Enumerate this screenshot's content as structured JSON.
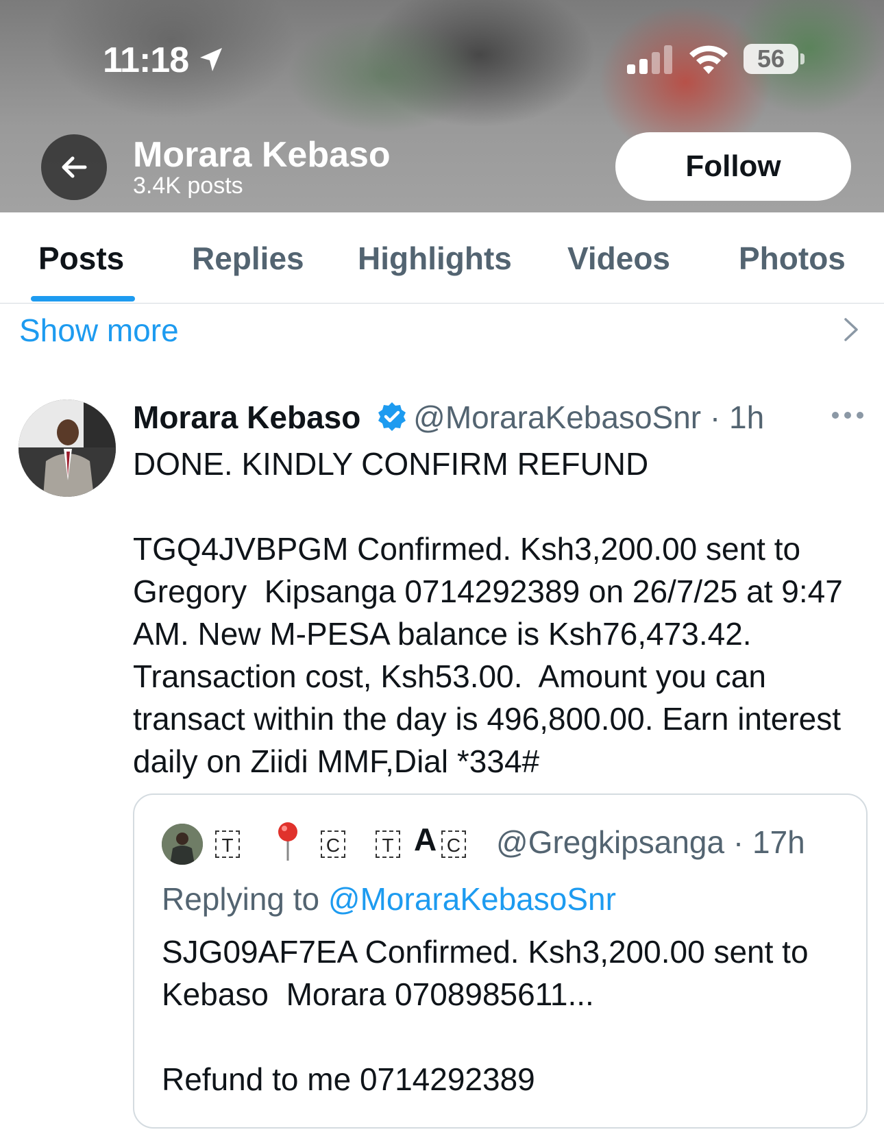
{
  "status_bar": {
    "time": "11:18",
    "battery": "56"
  },
  "header": {
    "name": "Morara Kebaso",
    "posts_count": "3.4K posts",
    "follow_label": "Follow"
  },
  "tabs": [
    {
      "label": "Posts",
      "active": true
    },
    {
      "label": "Replies",
      "active": false
    },
    {
      "label": "Highlights",
      "active": false
    },
    {
      "label": "Videos",
      "active": false
    },
    {
      "label": "Photos",
      "active": false
    }
  ],
  "show_more": "Show more",
  "post": {
    "author_name": "Morara Kebaso",
    "handle": "@MoraraKebasoSnr",
    "separator": "·",
    "time": "1h",
    "text": "DONE. KINDLY CONFIRM REFUND\n\nTGQ4JVBPGM Confirmed. Ksh3,200.00 sent to Gregory  Kipsanga 0714292389 on 26/7/25 at 9:47 AM. New M-PESA balance is Ksh76,473.42. Transaction cost, Ksh53.00.  Amount you can transact within the day is 496,800.00. Earn interest daily on Ziidi MMF,Dial *334#"
  },
  "quoted_post": {
    "handle": "@Gregkipsanga",
    "separator": "·",
    "time": "17h",
    "replying_prefix": "Replying to ",
    "replying_to": "@MoraraKebasoSnr",
    "text": "SJG09AF7EA Confirmed. Ksh3,200.00 sent to Kebaso  Morara 0708985611...\n\nRefund to me 0714292389"
  },
  "colors": {
    "accent": "#1d9bf0",
    "secondary_text": "#536471",
    "primary_text": "#0f1419"
  }
}
